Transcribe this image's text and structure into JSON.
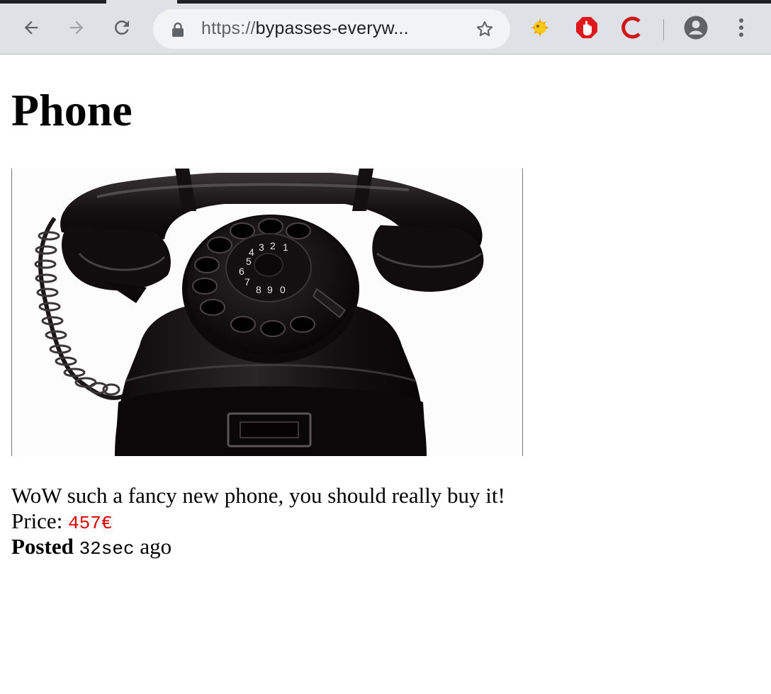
{
  "browser": {
    "url_scheme": "https://",
    "url_rest": "bypasses-everyw...",
    "icons": {
      "back": "back-arrow-icon",
      "forward": "forward-arrow-icon",
      "reload": "reload-icon",
      "lock": "lock-icon",
      "bookmark": "star-icon",
      "ext1": "extension-sun-icon",
      "ext2": "stop-hand-icon",
      "ext3": "red-c-icon",
      "profile": "profile-icon",
      "menu": "kebab-menu-icon"
    }
  },
  "page": {
    "title": "Phone",
    "image_alt": "black rotary telephone",
    "description": "WoW such a fancy new phone, you should really buy it!",
    "price_label": "Price: ",
    "price_value": "457€",
    "posted_label": "Posted",
    "posted_value": "32sec",
    "posted_suffix": " ago"
  },
  "colors": {
    "price": "#e00000",
    "chrome_bg": "#dee1e6",
    "omnibox_bg": "#f1f3f4"
  }
}
